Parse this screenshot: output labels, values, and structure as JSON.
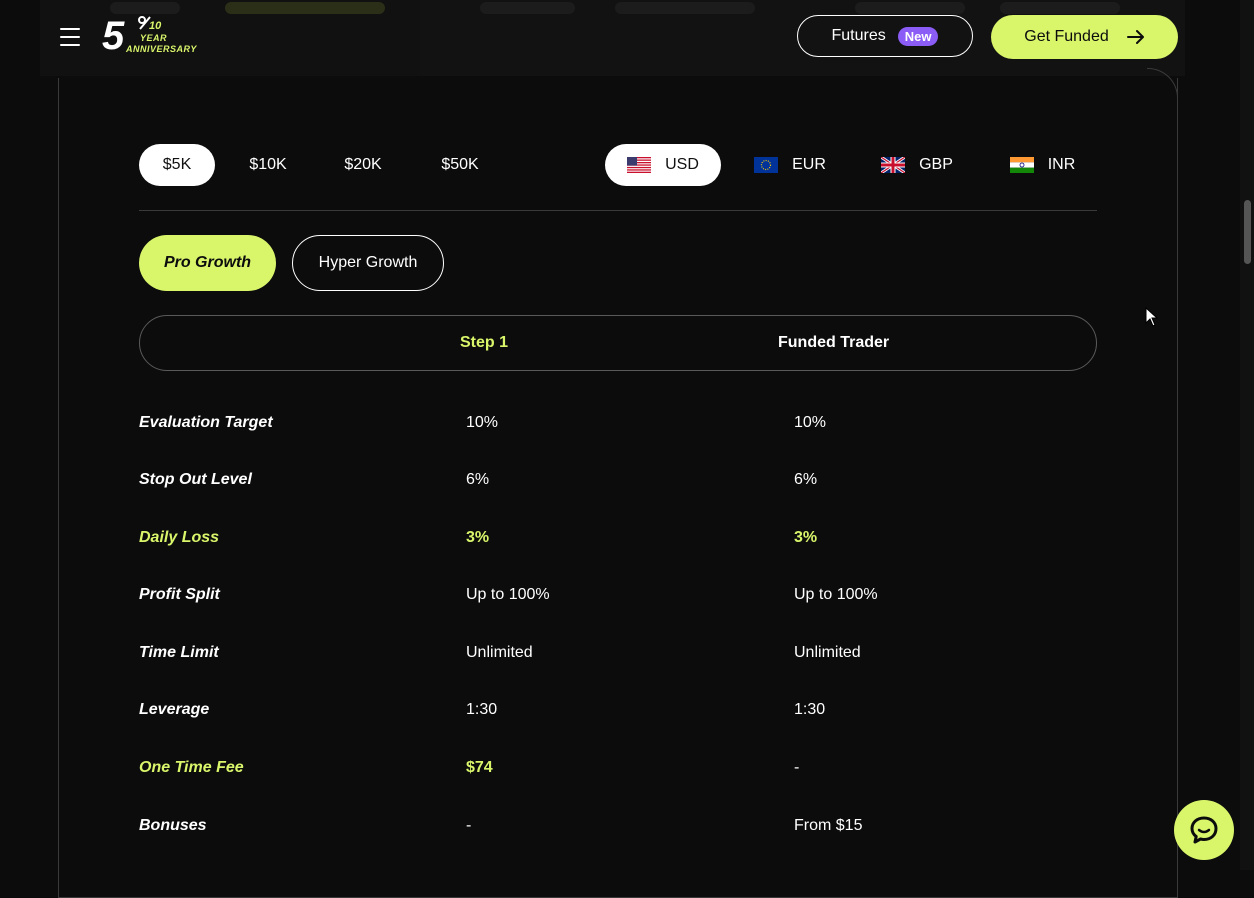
{
  "header": {
    "logo": {
      "five": "5",
      "ten": "10",
      "year": "YEAR",
      "anniversary": "ANNIVERSARY"
    },
    "futures_label": "Futures",
    "futures_badge": "New",
    "cta_label": "Get Funded"
  },
  "account_sizes": [
    {
      "label": "$5K",
      "active": true
    },
    {
      "label": "$10K",
      "active": false
    },
    {
      "label": "$20K",
      "active": false
    },
    {
      "label": "$50K",
      "active": false
    }
  ],
  "currencies": [
    {
      "label": "USD",
      "flag": "us-flag-icon",
      "active": true
    },
    {
      "label": "EUR",
      "flag": "eu-flag-icon",
      "active": false
    },
    {
      "label": "GBP",
      "flag": "uk-flag-icon",
      "active": false
    },
    {
      "label": "INR",
      "flag": "india-flag-icon",
      "active": false
    }
  ],
  "plans": [
    {
      "label": "Pro Growth",
      "active": true
    },
    {
      "label": "Hyper Growth",
      "active": false
    }
  ],
  "steps": [
    "Step 1",
    "Funded Trader"
  ],
  "rows": [
    {
      "label": "Evaluation Target",
      "step1": "10%",
      "funded": "10%",
      "highlight": false
    },
    {
      "label": "Stop Out Level",
      "step1": "6%",
      "funded": "6%",
      "highlight": false
    },
    {
      "label": "Daily Loss",
      "step1": "3%",
      "funded": "3%",
      "highlight": true
    },
    {
      "label": "Profit Split",
      "step1": "Up to 100%",
      "funded": "Up to 100%",
      "highlight": false
    },
    {
      "label": "Time Limit",
      "step1": "Unlimited",
      "funded": "Unlimited",
      "highlight": false
    },
    {
      "label": "Leverage",
      "step1": "1:30",
      "funded": "1:30",
      "highlight": false
    },
    {
      "label": "One Time Fee",
      "step1": "$74",
      "funded": "-",
      "highlight": true
    },
    {
      "label": "Bonuses",
      "step1": "-",
      "funded": "From $15",
      "highlight": false
    }
  ],
  "colors": {
    "accent": "#d9f66b",
    "badge": "#8b5cf6",
    "background": "#0c0c0c"
  }
}
